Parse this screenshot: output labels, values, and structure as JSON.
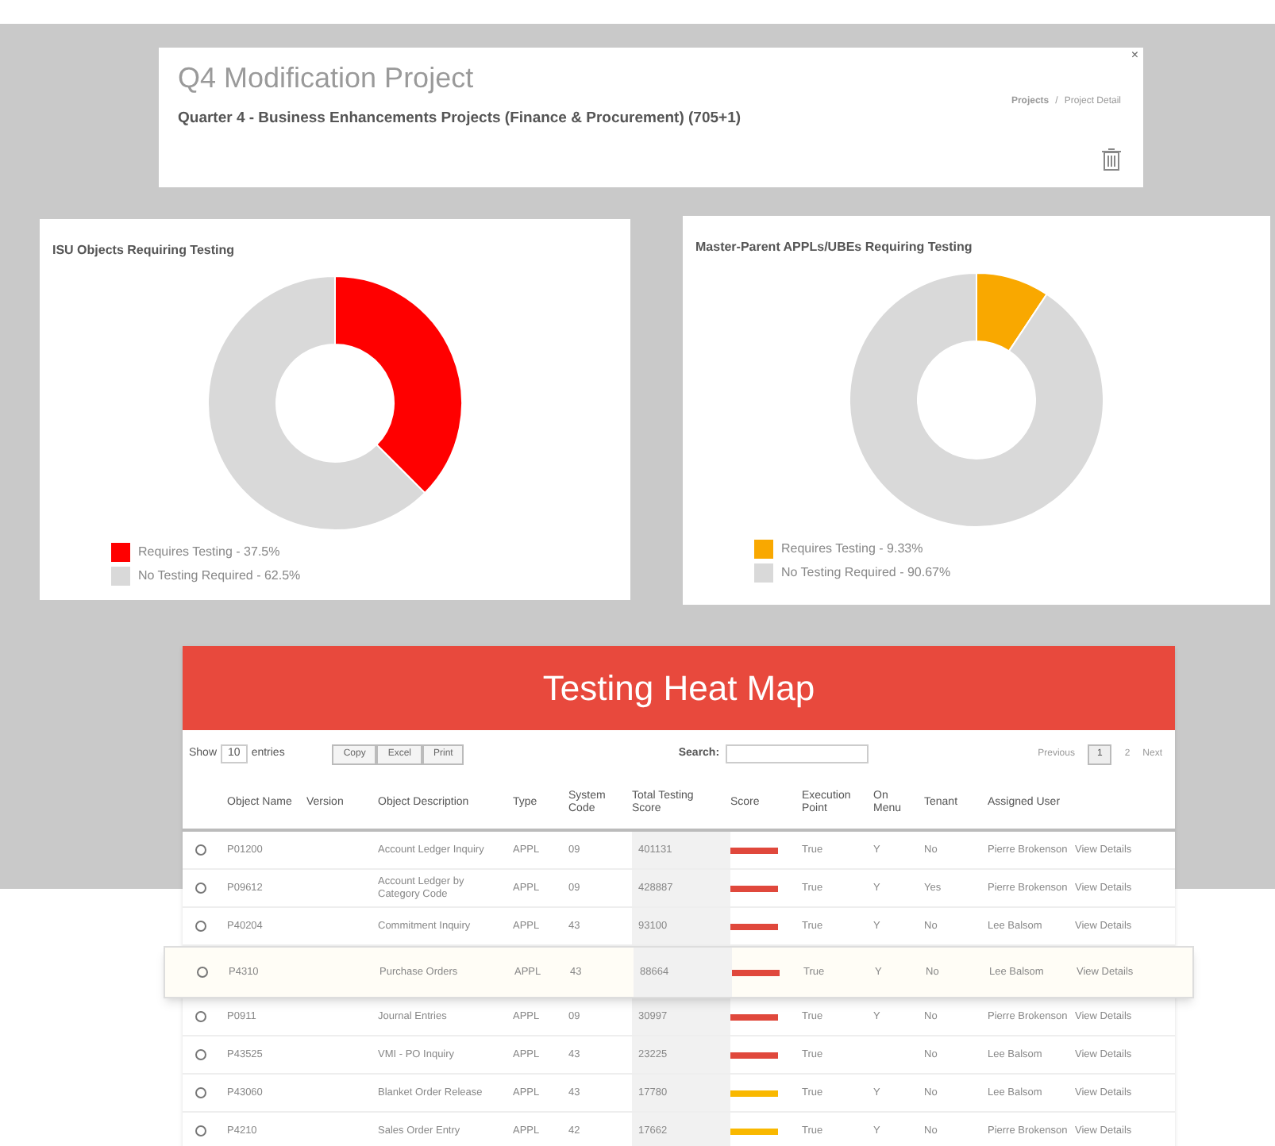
{
  "project": {
    "title": "Q4 Modification Project",
    "subtitle": "Quarter 4 - Business Enhancements Projects (Finance & Procurement) (705+1)",
    "breadcrumb": [
      "Projects",
      "Project Detail"
    ],
    "breadcrumb_separator": "/",
    "close": "×"
  },
  "charts": [
    {
      "chart_data": {
        "type": "donut",
        "title": "ISU Objects Requiring Testing",
        "categories": [
          "Requires Testing - 37.5%",
          "No Testing Required - 62.5%"
        ],
        "values": [
          37.5,
          62.5
        ],
        "colors": [
          "#ff0000",
          "#d9d9d9"
        ]
      }
    },
    {
      "chart_data": {
        "type": "donut",
        "title": "Master-Parent APPLs/UBEs Requiring Testing",
        "categories": [
          "Requires Testing - 9.33%",
          "No Testing Required - 90.67%"
        ],
        "values": [
          9.33,
          90.67
        ],
        "colors": [
          "#f9a800",
          "#d9d9d9"
        ]
      }
    }
  ],
  "heat_map": {
    "title": "Testing Heat Map",
    "show_label": "Show",
    "page_size": "10",
    "entries_label": "entries",
    "buttons": [
      "Copy",
      "Excel",
      "Print"
    ],
    "search_label": "Search:",
    "pagination": [
      {
        "label": "Previous",
        "selected": false
      },
      {
        "label": "1",
        "selected": true
      },
      {
        "label": "2",
        "selected": false
      },
      {
        "label": "Next",
        "selected": false
      }
    ],
    "columns": [
      "Object Name",
      "Version",
      "Object Description",
      "Type",
      "System Code",
      "Total Testing Score",
      "Score",
      "Execution Point",
      "On Menu",
      "Tenant",
      "Assigned User"
    ],
    "rows": [
      {
        "name": "P01200",
        "version": "",
        "description": "Account Ledger Inquiry",
        "type": "APPL",
        "system_code": "09",
        "total": "401131",
        "color": "#e0483c",
        "execution": "True",
        "menu": "Y",
        "tenant": "No",
        "user": "Pierre Brokenson",
        "action": "View Details",
        "selected": false
      },
      {
        "name": "P09612",
        "version": "",
        "description": "Account Ledger by Category Code",
        "type": "APPL",
        "system_code": "09",
        "total": "428887",
        "color": "#e0483c",
        "execution": "True",
        "menu": "Y",
        "tenant": "Yes",
        "user": "Pierre Brokenson",
        "action": "View Details",
        "selected": false
      },
      {
        "name": "P40204",
        "version": "",
        "description": "Commitment Inquiry",
        "type": "APPL",
        "system_code": "43",
        "total": "93100",
        "color": "#e0483c",
        "execution": "True",
        "menu": "Y",
        "tenant": "No",
        "user": "Lee Balsom",
        "action": "View Details",
        "selected": false
      },
      {
        "name": "P4310",
        "version": "",
        "description": "Purchase Orders",
        "type": "APPL",
        "system_code": "43",
        "total": "88664",
        "color": "#e0483c",
        "execution": "True",
        "menu": "Y",
        "tenant": "No",
        "user": "Lee Balsom",
        "action": "View Details",
        "selected": true
      },
      {
        "name": "P0911",
        "version": "",
        "description": "Journal Entries",
        "type": "APPL",
        "system_code": "09",
        "total": "30997",
        "color": "#e0483c",
        "execution": "True",
        "menu": "Y",
        "tenant": "No",
        "user": "Pierre Brokenson",
        "action": "View Details",
        "selected": false
      },
      {
        "name": "P43525",
        "version": "",
        "description": "VMI - PO Inquiry",
        "type": "APPL",
        "system_code": "43",
        "total": "23225",
        "color": "#e0483c",
        "execution": "True",
        "menu": "",
        "tenant": "No",
        "user": "Lee Balsom",
        "action": "View Details",
        "selected": false
      },
      {
        "name": "P43060",
        "version": "",
        "description": "Blanket Order Release",
        "type": "APPL",
        "system_code": "43",
        "total": "17780",
        "color": "#f9b800",
        "execution": "True",
        "menu": "Y",
        "tenant": "No",
        "user": "Lee Balsom",
        "action": "View Details",
        "selected": false
      },
      {
        "name": "P4210",
        "version": "",
        "description": "Sales Order Entry",
        "type": "APPL",
        "system_code": "42",
        "total": "17662",
        "color": "#f9b800",
        "execution": "True",
        "menu": "Y",
        "tenant": "No",
        "user": "Pierre Brokenson",
        "action": "View Details",
        "selected": false
      }
    ]
  }
}
